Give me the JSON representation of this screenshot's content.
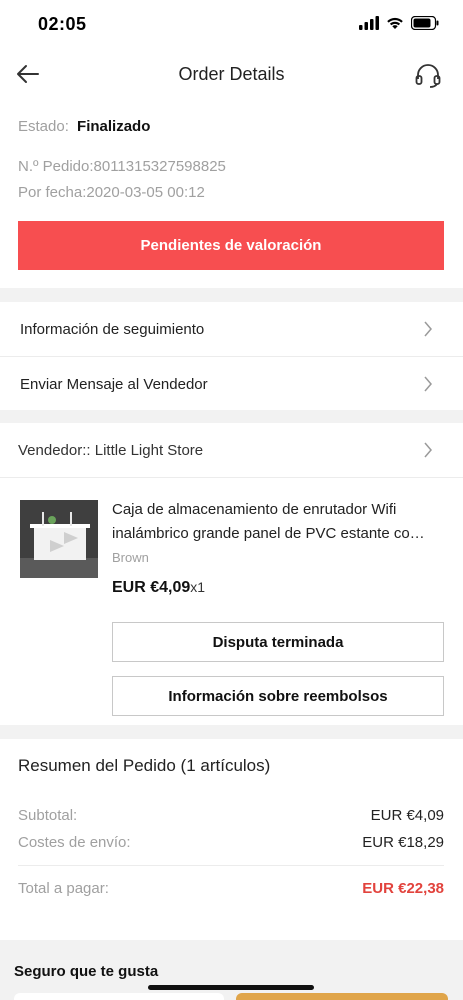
{
  "status_bar": {
    "time": "02:05"
  },
  "nav": {
    "title": "Order Details",
    "back_icon": "arrow-left-icon",
    "support_icon": "headset-icon"
  },
  "order": {
    "estado_label": "Estado:",
    "estado_value": "Finalizado",
    "order_number": "N.º Pedido:8011315327598825",
    "order_date": "Por fecha:2020-03-05 00:12",
    "primary_action": "Pendientes de valoración"
  },
  "links": {
    "tracking": "Información de seguimiento",
    "message_seller": "Enviar Mensaje al Vendedor"
  },
  "seller": {
    "label": "Vendedor:: Little Light Store"
  },
  "product": {
    "title": "Caja de almacenamiento de enrutador Wifi inalámbrico grande panel de PVC estante co…",
    "variant": "Brown",
    "price": "EUR €4,09",
    "quantity": "x1",
    "dispute_button": "Disputa terminada",
    "refund_button": "Información sobre reembolsos"
  },
  "summary": {
    "title": "Resumen del Pedido (1 artículos)",
    "subtotal_label": "Subtotal:",
    "subtotal_value": "EUR €4,09",
    "shipping_label": "Costes de envío:",
    "shipping_value": "EUR €18,29",
    "total_label": "Total a pagar:",
    "total_value": "EUR €22,38"
  },
  "recommend": {
    "title": "Seguro que te gusta"
  },
  "colors": {
    "accent": "#f74e50",
    "total": "#e2433d",
    "muted": "#a0a0a0",
    "separator": "#f2f2f2"
  }
}
